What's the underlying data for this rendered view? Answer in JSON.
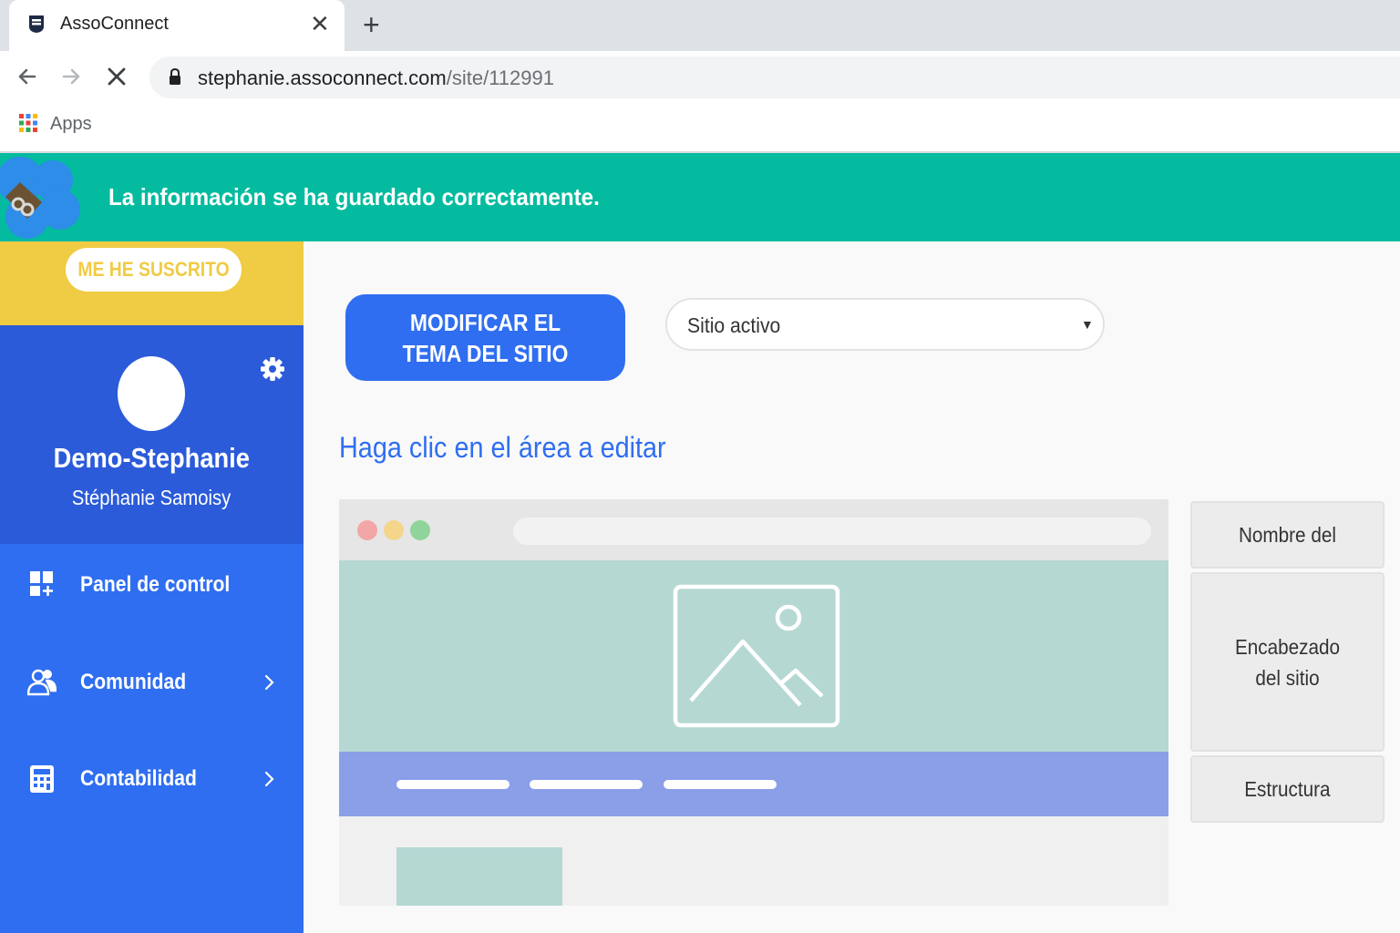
{
  "browser": {
    "tab_title": "AssoConnect",
    "tab_close": "✕",
    "new_tab": "+",
    "url_host": "stephanie.assoconnect.com",
    "url_path": "/site/112991",
    "bookmark_apps": "Apps"
  },
  "notification": {
    "message": "La información se ha guardado correctamente.",
    "color": "#04bb9f"
  },
  "sidebar": {
    "subscribed_label": "ME HE SUSCRITO",
    "org_name": "Demo-Stephanie",
    "user_name": "Stéphanie Samoisy",
    "items": [
      {
        "label": "Panel de control",
        "icon": "dashboard-icon",
        "has_chevron": false
      },
      {
        "label": "Comunidad",
        "icon": "community-icon",
        "has_chevron": true
      },
      {
        "label": "Contabilidad",
        "icon": "calculator-icon",
        "has_chevron": true
      }
    ],
    "colors": {
      "yellow": "#f0cb44",
      "profile_blue": "#2b5bd9",
      "nav_blue": "#2f6ef0"
    }
  },
  "main": {
    "theme_button": "MODIFICAR EL TEMA DEL SITIO",
    "status_select": {
      "value": "Sitio activo",
      "arrow": "▼"
    },
    "edit_heading": "Haga clic en el área a editar",
    "panel": [
      "Nombre del",
      "Encabezado del sitio",
      "Estructura"
    ]
  }
}
